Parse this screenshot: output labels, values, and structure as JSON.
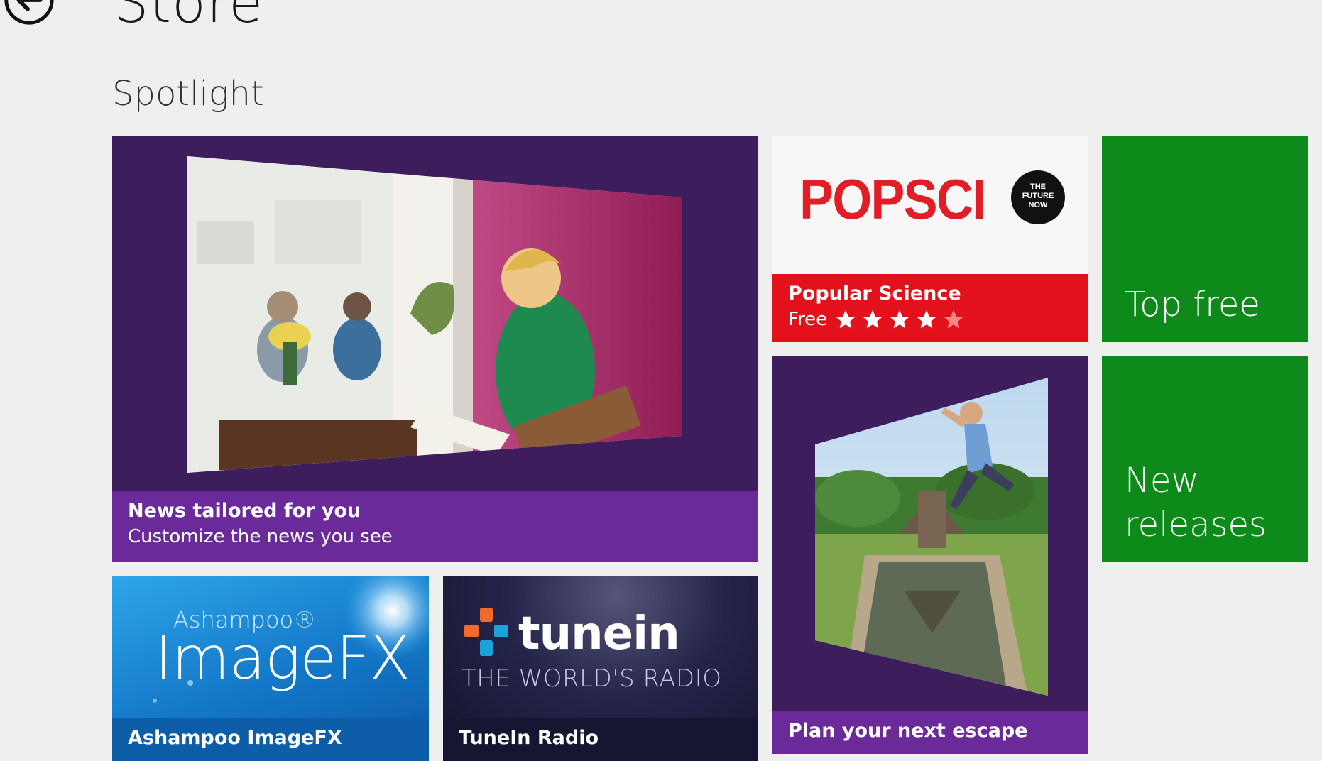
{
  "header": {
    "title": "Store",
    "back_icon": "back-arrow-icon"
  },
  "section": {
    "title": "Spotlight"
  },
  "tiles": {
    "news": {
      "title": "News tailored for you",
      "subtitle": "Customize the news you see"
    },
    "popsci": {
      "logo_text": "POPSCI",
      "badge_lines": [
        "THE",
        "FUTURE",
        "NOW"
      ],
      "title": "Popular Science",
      "price": "Free",
      "rating": 4,
      "rating_max": 5
    },
    "top_free": {
      "label": "Top free"
    },
    "new_releases": {
      "label_line1": "New",
      "label_line2": "releases"
    },
    "escape": {
      "title": "Plan your next escape"
    },
    "ashampoo": {
      "brand": "Ashampoo®",
      "logo": "ImageFX",
      "title": "Ashampoo ImageFX"
    },
    "tunein": {
      "logo": "tunein",
      "tagline": "THE WORLD'S RADIO",
      "title": "TuneIn Radio"
    }
  },
  "colors": {
    "background": "#efefef",
    "tile_purple": "#3d1d5b",
    "bar_purple": "#6b2a99",
    "popsci_red": "#e3111b",
    "tile_green": "#0d8a19",
    "ashampoo_blue": "#1377c8",
    "tunein_navy": "#161632"
  }
}
